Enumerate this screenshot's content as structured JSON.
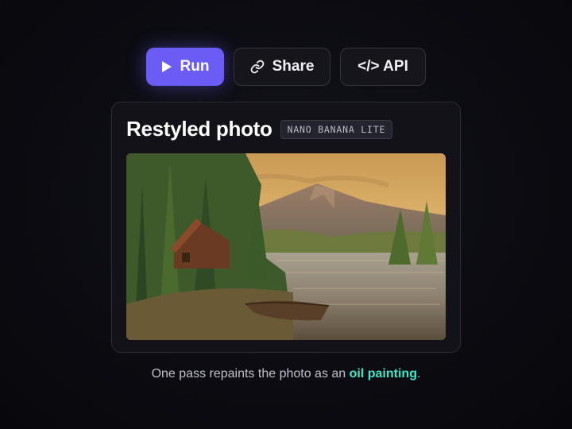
{
  "toolbar": {
    "run_label": "Run",
    "share_label": "Share",
    "api_label": "</> API",
    "run_color": "#6b5cf6"
  },
  "card": {
    "title": "Restyled photo",
    "badge": "NANO BANANA LITE",
    "image_description": "oil painting of a lakeside cabin with rowboat, pine trees and mountains at sunset"
  },
  "caption": {
    "prefix": "One pass repaints the photo as an ",
    "highlight": "oil painting",
    "suffix": ".",
    "highlight_color": "#3ee8c8"
  },
  "icons": [
    "play-icon",
    "link-icon"
  ]
}
